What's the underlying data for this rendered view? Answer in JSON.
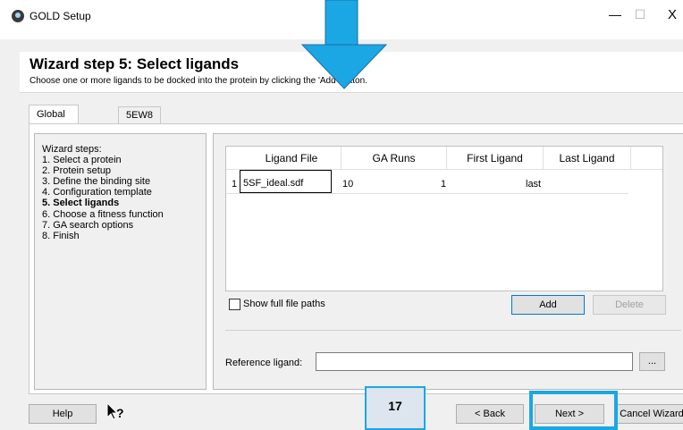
{
  "window": {
    "title": "GOLD Setup",
    "minimize": "—",
    "maximize": "☐",
    "close": "X"
  },
  "header": {
    "title": "Wizard step 5: Select ligands",
    "subtitle": "Choose one or more ligands to be docked into the protein by clicking the 'Add' button."
  },
  "tabs": [
    {
      "label": "Global Options",
      "active": true
    },
    {
      "label": "5EW8",
      "active": false
    }
  ],
  "steps": {
    "title": "Wizard steps:",
    "items": [
      {
        "label": "1. Select a protein",
        "bold": false
      },
      {
        "label": "2. Protein setup",
        "bold": false
      },
      {
        "label": "3. Define the binding site",
        "bold": false
      },
      {
        "label": "4. Configuration template",
        "bold": false
      },
      {
        "label": "5. Select ligands",
        "bold": true
      },
      {
        "label": "6. Choose a fitness function",
        "bold": false
      },
      {
        "label": "7. GA search options",
        "bold": false
      },
      {
        "label": "8. Finish",
        "bold": false
      }
    ]
  },
  "ligand_table": {
    "columns": [
      "Ligand File",
      "GA Runs",
      "First Ligand",
      "Last Ligand"
    ],
    "rows": [
      {
        "num": "1",
        "file": "5SF_ideal.sdf",
        "ga_runs": "10",
        "first": "1",
        "last": "last"
      }
    ]
  },
  "options": {
    "show_full_paths_label": "Show full file paths",
    "show_full_paths_checked": false,
    "add_label": "Add",
    "delete_label": "Delete",
    "reference_label": "Reference ligand:",
    "reference_value": "",
    "browse_label": "..."
  },
  "footer": {
    "help_label": "Help",
    "back_label": "< Back",
    "next_label": "Next >",
    "cancel_label": "Cancel Wizard",
    "badge": "17"
  },
  "colors": {
    "highlight": "#1ba7e4",
    "arrow": "#1ba7e4"
  }
}
